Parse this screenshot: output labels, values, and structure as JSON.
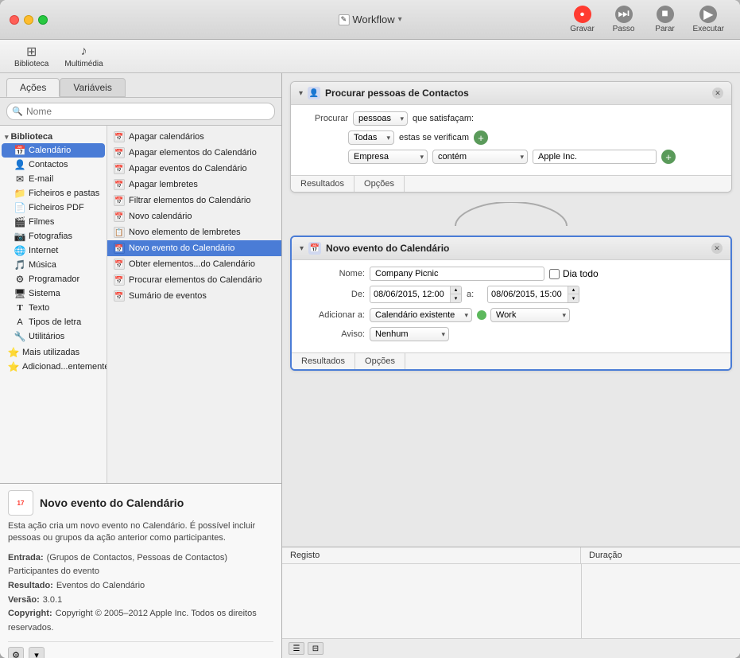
{
  "window": {
    "title": "Workflow",
    "title_icon": "✎"
  },
  "toolbar": {
    "record_label": "Gravar",
    "step_label": "Passo",
    "stop_label": "Parar",
    "run_label": "Executar"
  },
  "second_toolbar": {
    "library_label": "Biblioteca",
    "multimedia_label": "Multimédia"
  },
  "left_panel": {
    "tabs": [
      {
        "label": "Ações",
        "active": true
      },
      {
        "label": "Variáveis",
        "active": false
      }
    ],
    "search_placeholder": "Nome",
    "tree": {
      "section_label": "Biblioteca",
      "items": [
        {
          "label": "Calendário",
          "icon": "📅",
          "selected": true
        },
        {
          "label": "Contactos",
          "icon": "👤"
        },
        {
          "label": "E-mail",
          "icon": "✉"
        },
        {
          "label": "Ficheiros e pastas",
          "icon": "📁"
        },
        {
          "label": "Ficheiros PDF",
          "icon": "📄"
        },
        {
          "label": "Filmes",
          "icon": "🎬"
        },
        {
          "label": "Fotografias",
          "icon": "📷"
        },
        {
          "label": "Internet",
          "icon": "🌐"
        },
        {
          "label": "Música",
          "icon": "🎵"
        },
        {
          "label": "Programador",
          "icon": "⚙"
        },
        {
          "label": "Sistema",
          "icon": "🖥"
        },
        {
          "label": "Texto",
          "icon": "T"
        },
        {
          "label": "Tipos de letra",
          "icon": "A"
        },
        {
          "label": "Utilitários",
          "icon": "🔧"
        },
        {
          "label": "Mais utilizadas",
          "icon": "⭐"
        },
        {
          "label": "Adicionad...entemente",
          "icon": "⭐"
        }
      ]
    },
    "actions": [
      {
        "label": "Apagar calendários",
        "icon": "📅"
      },
      {
        "label": "Apagar elementos do Calendário",
        "icon": "📅"
      },
      {
        "label": "Apagar eventos do Calendário",
        "icon": "📅"
      },
      {
        "label": "Apagar lembretes",
        "icon": "📅"
      },
      {
        "label": "Filtrar elementos do Calendário",
        "icon": "📅"
      },
      {
        "label": "Novo calendário",
        "icon": "📅"
      },
      {
        "label": "Novo elemento de lembretes",
        "icon": "📋"
      },
      {
        "label": "Novo evento do Calendário",
        "icon": "📅",
        "selected": true
      },
      {
        "label": "Obter elementos...do Calendário",
        "icon": "📅"
      },
      {
        "label": "Procurar elementos do Calendário",
        "icon": "📅"
      },
      {
        "label": "Sumário de eventos",
        "icon": "📅"
      }
    ]
  },
  "info_panel": {
    "icon_day": "17",
    "title": "Novo evento do Calendário",
    "description": "Esta ação cria um novo evento no Calendário. É possível incluir pessoas ou grupos da ação anterior como participantes.",
    "entry_label": "Entrada:",
    "entry_value": "(Grupos de Contactos, Pessoas de Contactos) Participantes do evento",
    "result_label": "Resultado:",
    "result_value": "Eventos do Calendário",
    "version_label": "Versão:",
    "version_value": "3.0.1",
    "copyright_label": "Copyright:",
    "copyright_value": "Copyright © 2005–2012 Apple Inc. Todos os direitos reservados."
  },
  "workflow": {
    "cards": [
      {
        "id": "card1",
        "title": "Procurar pessoas de Contactos",
        "icon": "👤",
        "fields": {
          "search_label": "Procurar",
          "search_value": "pessoas",
          "satisfy_label": "que satisfaçam:",
          "conditions_label": "Todas",
          "conditions_suffix": "estas se verificam",
          "field_label": "Empresa",
          "operator_label": "contém",
          "value": "Apple Inc."
        },
        "tabs": [
          "Resultados",
          "Opções"
        ]
      },
      {
        "id": "card2",
        "title": "Novo evento do Calendário",
        "icon": "📅",
        "fields": {
          "name_label": "Nome:",
          "name_value": "Company Picnic",
          "all_day_label": "Dia todo",
          "from_label": "De:",
          "from_value": "08/06/2015, 12:00",
          "to_label": "a:",
          "to_value": "08/06/2015, 15:00",
          "add_to_label": "Adicionar a:",
          "add_to_value": "Calendário existente",
          "calendar_label": "Work",
          "calendar_color": "#5cb85c",
          "alert_label": "Aviso:",
          "alert_value": "Nenhum"
        },
        "tabs": [
          "Resultados",
          "Opções"
        ]
      }
    ]
  },
  "log_panel": {
    "registry_label": "Registo",
    "duration_label": "Duração"
  }
}
